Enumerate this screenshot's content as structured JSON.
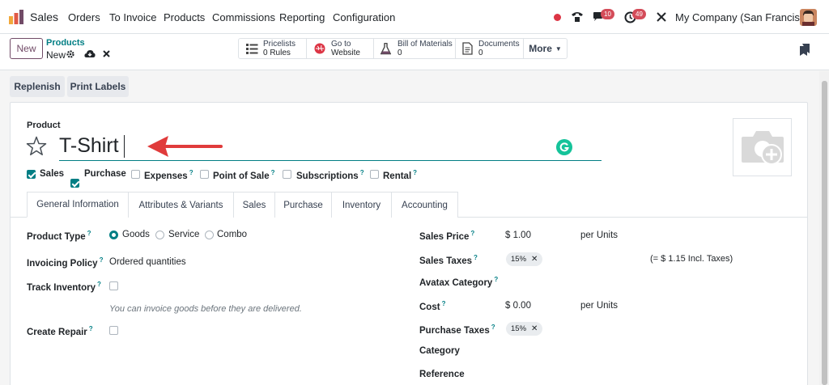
{
  "nav": {
    "app": "Sales",
    "menu": [
      "Orders",
      "To Invoice",
      "Products",
      "Commissions",
      "Reporting",
      "Configuration"
    ],
    "messages_count": "10",
    "activities_count": "49",
    "company": "My Company (San Francisco)"
  },
  "control": {
    "new_label": "New",
    "breadcrumb": "Products",
    "record_title": "New",
    "smart_buttons": [
      {
        "line1": "Pricelists",
        "line2": "0 Rules",
        "icon": "list-icon"
      },
      {
        "line1": "Go to",
        "line2": "Website",
        "icon": "globe-icon"
      },
      {
        "line1": "Bill of Materials",
        "line2": "0",
        "icon": "flask-icon"
      },
      {
        "line1": "Documents",
        "line2": "0",
        "icon": "document-icon"
      }
    ],
    "more_label": "More"
  },
  "actions": {
    "replenish": "Replenish",
    "print_labels": "Print Labels"
  },
  "form": {
    "product_label": "Product",
    "product_name": "T-Shirt",
    "flags": [
      {
        "label": "Sales",
        "checked": true,
        "help": false
      },
      {
        "label": "Purchase",
        "checked": true,
        "help": false
      },
      {
        "label": "Expenses",
        "checked": false,
        "help": true
      },
      {
        "label": "Point of Sale",
        "checked": false,
        "help": true
      },
      {
        "label": "Subscriptions",
        "checked": false,
        "help": true
      },
      {
        "label": "Rental",
        "checked": false,
        "help": true
      }
    ],
    "tabs": [
      "General Information",
      "Attributes & Variants",
      "Sales",
      "Purchase",
      "Inventory",
      "Accounting"
    ],
    "help_mark": "?",
    "left": {
      "product_type_label": "Product Type",
      "product_type_options": [
        "Goods",
        "Service",
        "Combo"
      ],
      "product_type_selected": "Goods",
      "invoicing_policy_label": "Invoicing Policy",
      "invoicing_policy_value": "Ordered quantities",
      "track_inventory_label": "Track Inventory",
      "invoice_hint": "You can invoice goods before they are delivered.",
      "create_repair_label": "Create Repair"
    },
    "right": {
      "sales_price_label": "Sales Price",
      "sales_price_value": "$ 1.00",
      "sales_price_unit": "per Units",
      "sales_taxes_label": "Sales Taxes",
      "sales_taxes_tag": "15%",
      "sales_taxes_incl": "(= $ 1.15 Incl. Taxes)",
      "avatax_label": "Avatax Category",
      "cost_label": "Cost",
      "cost_value": "$ 0.00",
      "cost_unit": "per Units",
      "purchase_taxes_label": "Purchase Taxes",
      "purchase_taxes_tag": "15%",
      "category_label": "Category",
      "reference_label": "Reference"
    }
  },
  "colors": {
    "brand": "#714b67",
    "accent": "#017e84",
    "arrow": "#e03b3b",
    "badge": "#d44c59"
  }
}
